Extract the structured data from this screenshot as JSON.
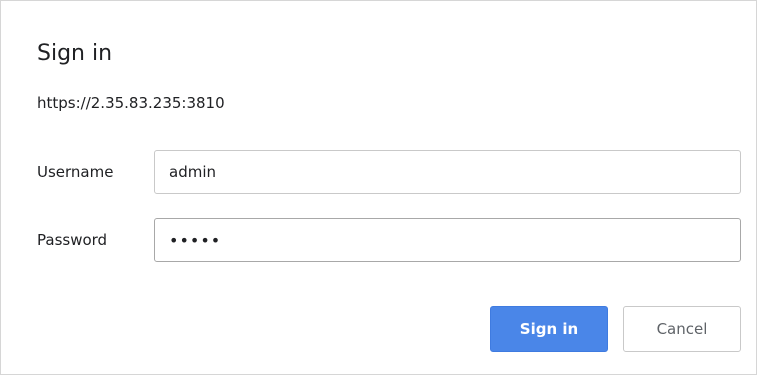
{
  "dialog": {
    "title": "Sign in",
    "origin": "https://2.35.83.235:3810",
    "username": {
      "label": "Username",
      "value": "admin"
    },
    "password": {
      "label": "Password",
      "value": "•••••"
    },
    "buttons": {
      "sign_in": "Sign in",
      "cancel": "Cancel"
    }
  }
}
